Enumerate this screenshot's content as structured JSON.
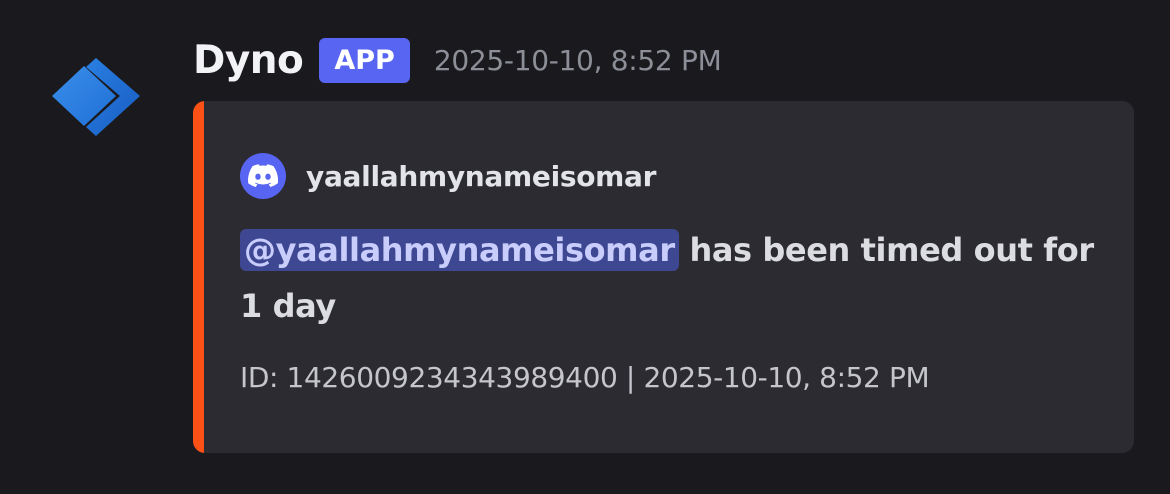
{
  "message": {
    "author": "Dyno",
    "badge": "APP",
    "timestamp": "2025-10-10, 8:52 PM",
    "avatar_icon": "dyno-logo-icon"
  },
  "embed": {
    "accent_color": "#fb5016",
    "author_icon": "discord-icon",
    "author_name": "yaallahmynameisomar",
    "mention": "@yaallahmynameisomar",
    "description": " has been timed out for 1 day",
    "footer": "ID: 1426009234343989400 | 2025-10-10, 8:52 PM"
  }
}
